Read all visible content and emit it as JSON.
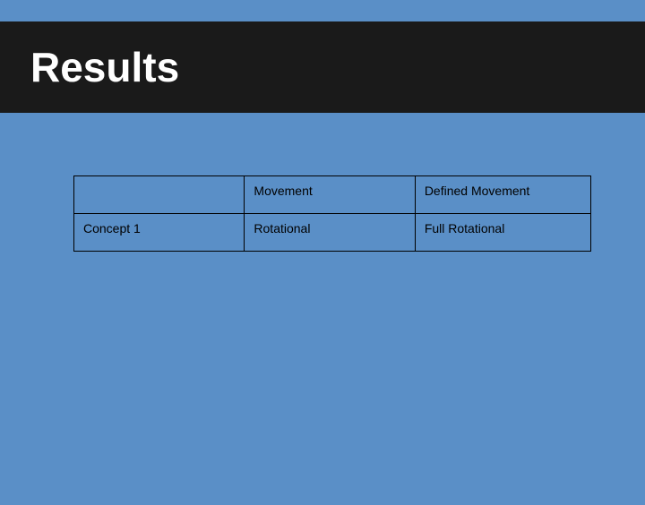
{
  "title": "Results",
  "table": {
    "header": {
      "col1": "",
      "col2": "Movement",
      "col3": "Defined Movement"
    },
    "rows": [
      {
        "col1": "Concept 1",
        "col2": "Rotational",
        "col3": "Full Rotational"
      }
    ]
  }
}
